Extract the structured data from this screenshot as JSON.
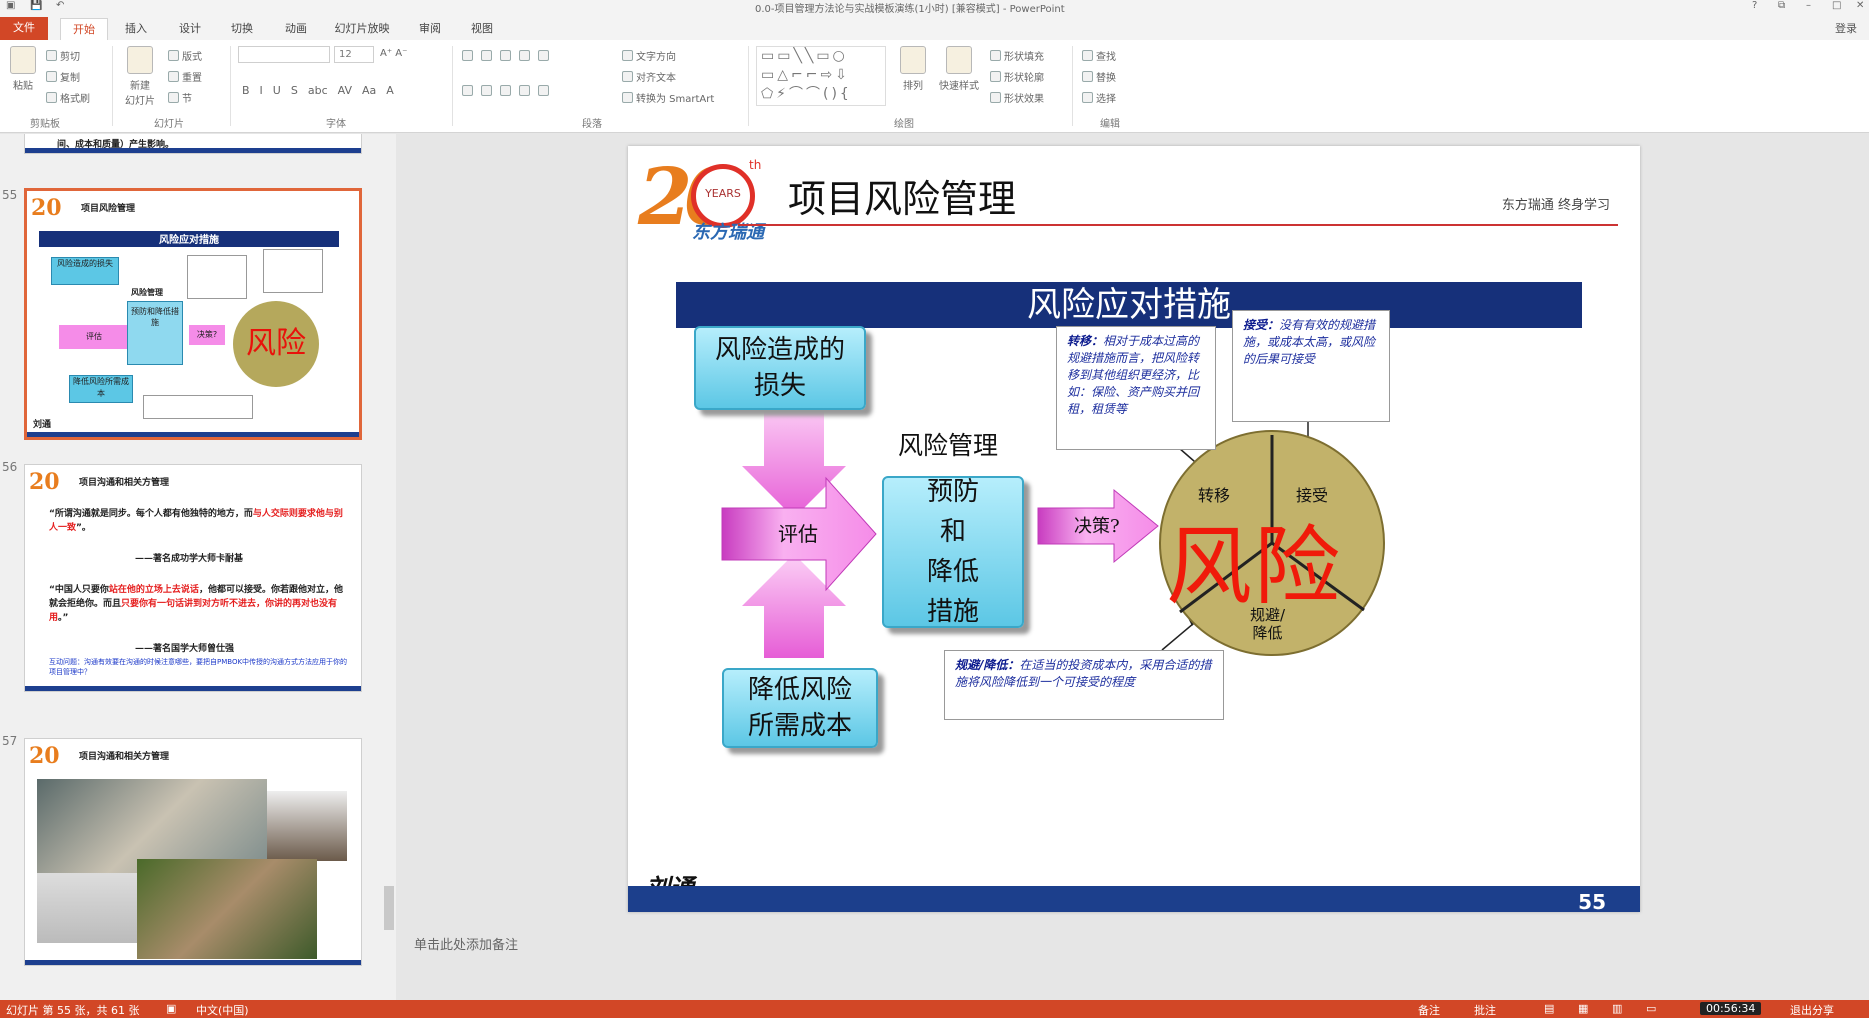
{
  "window": {
    "title": "0.0-项目管理方法论与实战模板演练(1小时)  [兼容模式] - PowerPoint",
    "help": "?",
    "restore": "⧉",
    "minimize": "–",
    "maximize": "□",
    "close": "✕"
  },
  "tabs": [
    "文件",
    "开始",
    "插入",
    "设计",
    "切换",
    "动画",
    "幻灯片放映",
    "审阅",
    "视图"
  ],
  "login": "登录",
  "ribbon": {
    "clipboard": {
      "paste": "粘贴",
      "cut": "剪切",
      "copy": "复制",
      "format_painter": "格式刷",
      "group": "剪贴板"
    },
    "slides": {
      "new_slide": "新建\n幻灯片",
      "layout": "版式",
      "reset": "重置",
      "section": "节",
      "group": "幻灯片"
    },
    "font": {
      "font_size": "12",
      "group": "字体",
      "tools": [
        "B",
        "I",
        "U",
        "S",
        "abc",
        "AV",
        "Aa",
        "A"
      ]
    },
    "paragraph": {
      "text_direction": "文字方向",
      "align_text": "对齐文本",
      "smartart": "转换为 SmartArt",
      "group": "段落"
    },
    "drawing": {
      "arrange": "排列",
      "quick_styles": "快速样式",
      "shape_fill": "形状填充",
      "shape_outline": "形状轮廓",
      "shape_effects": "形状效果",
      "group": "绘图"
    },
    "editing": {
      "find": "查找",
      "replace": "替换",
      "select": "选择",
      "group": "编辑"
    }
  },
  "thumbnails": [
    {
      "num": "",
      "top_text": "间、成本和质量）产生影响。"
    },
    {
      "num": "55",
      "title": "项目风险管理",
      "banner": "风险应对措施",
      "t1": "风险造成的损失",
      "t2": "评估",
      "t3": "预防和降低措施",
      "t4": "降低风险所需成本",
      "t5": "风险管理",
      "t6": "决策?",
      "big": "风险",
      "t7": "刘通"
    },
    {
      "num": "56",
      "title": "项目沟通和相关方管理",
      "q1": "“所谓沟通就是同步。每个人都有他独特的地方，而",
      "q1r": "与人交际则要求他与别人一致",
      "q1e": "”。",
      "a1": "——著名成功学大师卡耐基",
      "q2a": "“中国人只要你",
      "q2r1": "站在他的立场上去说话",
      "q2b": "，他都可以接受。你若跟他对立，他就会拒绝你。而且",
      "q2r2": "只要你有一句话讲到对方听不进去，你讲的再对也没有用",
      "q2c": "。”",
      "a2": "——著名国学大师曾仕强",
      "blue": "互动问题：沟通有效要在沟通的时候注意哪些，要把自PMBOK中传授的沟通方式方法应用于你的项目管理中？"
    },
    {
      "num": "57",
      "title": "项目沟通和相关方管理"
    }
  ],
  "slide": {
    "number": "55",
    "title": "项目风险管理",
    "tag": "东方瑞通  终身学习",
    "logo_num": "20",
    "logo_years": "YEARS",
    "logo_th": "th",
    "logo_cn": "东方瑞通",
    "banner": "风险应对措施",
    "box_loss": [
      "风险造成的",
      "损失"
    ],
    "box_prevent": [
      "预防",
      "和",
      "降低",
      "措施"
    ],
    "box_cost": [
      "降低风险",
      "所需成本"
    ],
    "label_rm": "风险管理",
    "arrow_eval": "评估",
    "arrow_decide": "决策?",
    "pie_big": "风险",
    "pie_transfer": "转移",
    "pie_accept": "接受",
    "pie_avoid": "规避/\n降低",
    "note_transfer_head": "转移：",
    "note_transfer": "相对于成本过高的规避措施而言，把风险转移到其他组织更经济，比如：保险、资产购买并回租，租赁等",
    "note_accept_head": "接受：",
    "note_accept": "没有有效的规避措施，或成本太高，或风险的后果可接受",
    "note_avoid_head": "规避/降低：",
    "note_avoid": "在适当的投资成本内，采用合适的措施将风险降低到一个可接受的程度",
    "signature": "刘通"
  },
  "notes_placeholder": "单击此处添加备注",
  "status": {
    "slide_info": "幻灯片 第 55 张，共 61 张",
    "lang": "中文(中国)",
    "notes": "备注",
    "comments": "批注",
    "time": "00:56:34",
    "exit_share": "退出分享"
  },
  "colors": {
    "accent": "#d24726",
    "banner": "#16307a",
    "pink": "#f58ce8",
    "cyan": "#5cc7e5",
    "pie": "#c9b86a"
  }
}
